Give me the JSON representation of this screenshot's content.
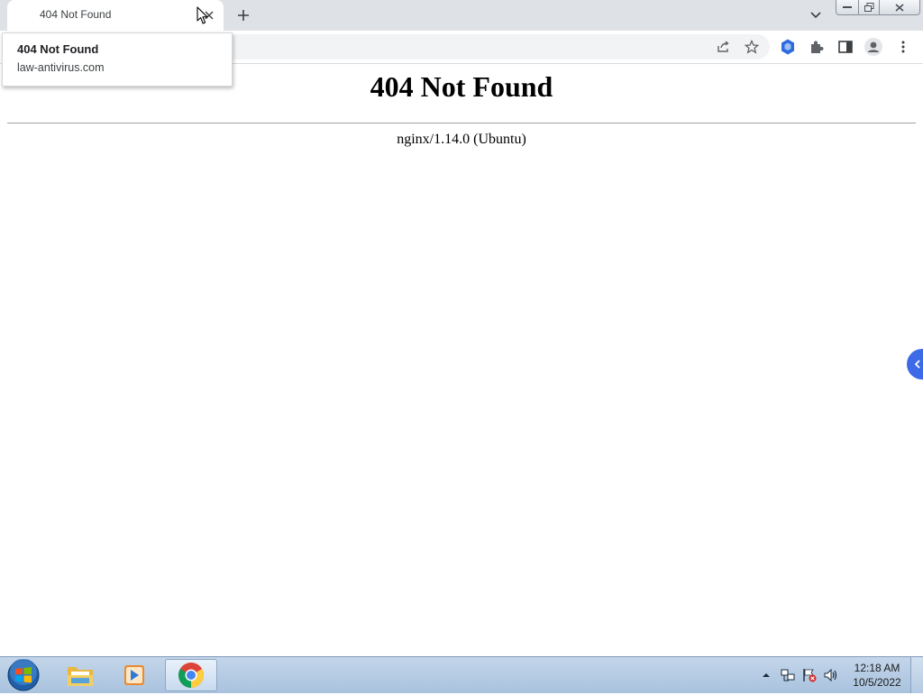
{
  "browser": {
    "tab": {
      "title": "404 Not Found"
    },
    "hover_card": {
      "title": "404 Not Found",
      "domain": "law-antivirus.com"
    },
    "accent_color": "#3d6be8"
  },
  "page": {
    "heading": "404 Not Found",
    "server_signature": "nginx/1.14.0 (Ubuntu)"
  },
  "taskbar": {
    "pinned": [
      {
        "name": "windows-explorer",
        "icon": "folder-icon"
      },
      {
        "name": "media-player",
        "icon": "media-player-icon"
      },
      {
        "name": "chrome",
        "icon": "chrome-icon",
        "active": true
      }
    ],
    "tray_icons": [
      "show-hidden-icons",
      "network-icon",
      "action-center-flag-icon",
      "volume-icon"
    ],
    "clock": {
      "time": "12:18 AM",
      "date": "10/5/2022"
    }
  }
}
